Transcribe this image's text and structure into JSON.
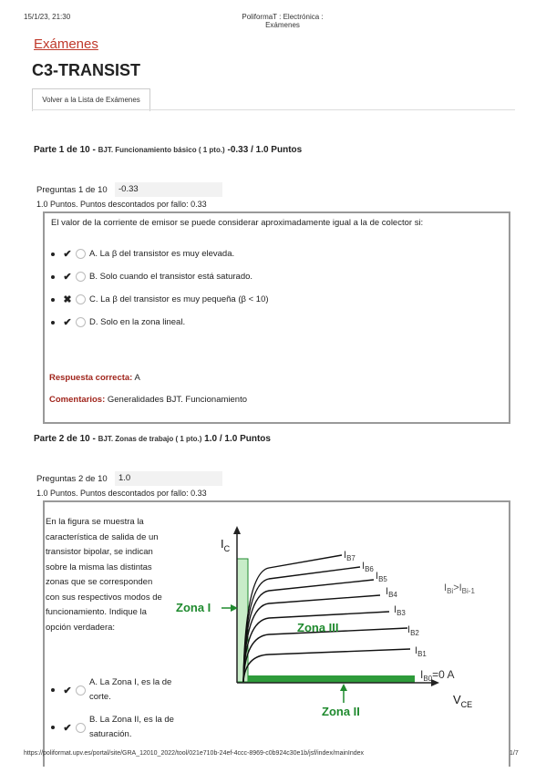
{
  "browser_header": {
    "datetime": "15/1/23, 21:30",
    "page_title": "PoliformaT : Electrónica : Exámenes"
  },
  "breadcrumb": "Exámenes",
  "exam_title": "C3-TRANSIST",
  "back_tab": "Volver a la Lista de Exámenes",
  "parts": [
    {
      "heading": "Parte 1 de 10 -",
      "subtitle": "BJT. Funcionamiento básico ( 1 pto.)",
      "score": "-0.33 / 1.0 Puntos",
      "question_label": "Preguntas 1 de 10",
      "question_score": "-0.33",
      "points_info": "1.0 Puntos. Puntos descontados por fallo: 0.33",
      "question_text": "El valor de la corriente de emisor se puede considerar aproximadamente igual a la de colector si:",
      "options": [
        {
          "mark": "✔",
          "text": "A. La β del transistor es muy elevada."
        },
        {
          "mark": "✔",
          "text": "B. Solo cuando el transistor está saturado."
        },
        {
          "mark": "✖",
          "text": "C. La β del transistor es muy pequeña (β < 10)"
        },
        {
          "mark": "✔",
          "text": "D. Solo en la zona lineal."
        }
      ],
      "correct_label": "Respuesta correcta:",
      "correct_value": "A",
      "comments_label": "Comentarios:",
      "comments_value": "Generalidades BJT. Funcionamiento"
    },
    {
      "heading": "Parte 2 de 10 -",
      "subtitle": "BJT. Zonas de trabajo ( 1 pto.)",
      "score": "1.0 / 1.0 Puntos",
      "question_label": "Preguntas 2 de 10",
      "question_score": "1.0",
      "points_info": "1.0 Puntos. Puntos descontados por fallo: 0.33",
      "question_text": "En la figura se muestra la característica de salida de un transistor bipolar, se indican sobre la misma las distintas zonas que se corresponden con sus respectivos modos de funcionamiento. Indique la opción verdadera:",
      "options": [
        {
          "mark": "✔",
          "text": "A. La Zona I, es la de corte."
        },
        {
          "mark": "✔",
          "text": "B. La Zona II, es la de saturación."
        }
      ],
      "figure": {
        "y_axis": "I",
        "y_sub": "C",
        "x_axis": "V",
        "x_sub": "CE",
        "zone1": "Zona I",
        "zone2": "Zona II",
        "zone3": "Zona III",
        "relation_base": "I",
        "relation_sub1": "Bi",
        "relation_mid": ">I",
        "relation_sub2": "Bi-1",
        "curves": [
          {
            "main": "I",
            "sub": "B7"
          },
          {
            "main": "I",
            "sub": "B6"
          },
          {
            "main": "I",
            "sub": "B5"
          },
          {
            "main": "I",
            "sub": "B4"
          },
          {
            "main": "I",
            "sub": "B3"
          },
          {
            "main": "I",
            "sub": "B2"
          },
          {
            "main": "I",
            "sub": "B1"
          }
        ],
        "ib0_main": "I",
        "ib0_sub": "B0",
        "ib0_value": "=0 A",
        "colors": {
          "zone": "#1f8a2e",
          "zone_fill": "#c8ecc8"
        }
      }
    }
  ],
  "footer": {
    "url": "https://poliformat.upv.es/portal/site/GRA_12010_2022/tool/021e710b-24ef-4ccc-8969-c0b924c30e1b/jsf/index/mainIndex",
    "page": "1/7"
  }
}
